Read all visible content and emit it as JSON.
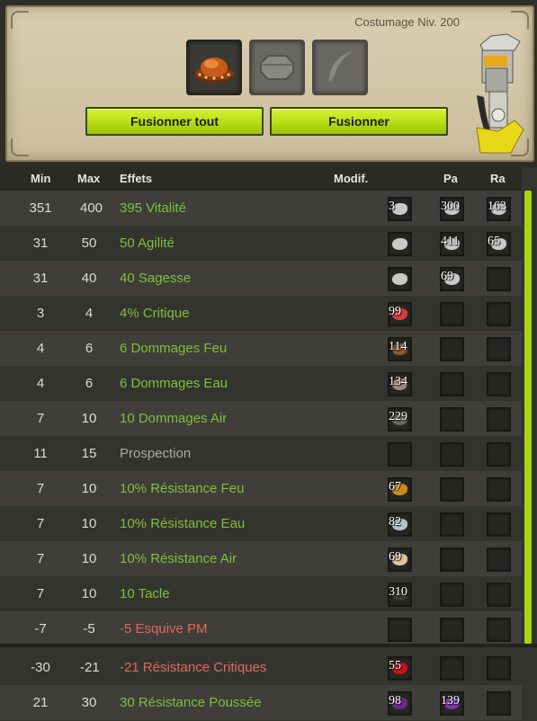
{
  "panel": {
    "title": "Costumage Niv. 200",
    "slots": [
      "hat-icon",
      "octagon-slot-icon",
      "feather-icon"
    ],
    "buttons": {
      "merge_all": "Fusionner tout",
      "merge": "Fusionner"
    }
  },
  "table": {
    "headers": {
      "min": "Min",
      "max": "Max",
      "effects": "Effets",
      "modif": "Modif.",
      "pa": "Pa",
      "ra": "Ra"
    },
    "rows": [
      {
        "min": "351",
        "max": "400",
        "effect": "395 Vitalité",
        "kind": "pos",
        "modif": "3",
        "pa": "300",
        "ra": "163",
        "color": "#c9c9c9"
      },
      {
        "min": "31",
        "max": "50",
        "effect": "50 Agilité",
        "kind": "pos",
        "modif": "",
        "pa": "411",
        "ra": "65",
        "color": "#c9c9c9"
      },
      {
        "min": "31",
        "max": "40",
        "effect": "40 Sagesse",
        "kind": "pos",
        "modif": "",
        "pa": "69",
        "ra": "",
        "color": "#c9c9c9"
      },
      {
        "min": "3",
        "max": "4",
        "effect": "4% Critique",
        "kind": "pos",
        "modif": "99",
        "pa": "",
        "ra": "",
        "color": "#d93a3a"
      },
      {
        "min": "4",
        "max": "6",
        "effect": "6 Dommages Feu",
        "kind": "pos",
        "modif": "114",
        "pa": "",
        "ra": "",
        "color": "#8a5a2a"
      },
      {
        "min": "4",
        "max": "6",
        "effect": "6 Dommages Eau",
        "kind": "pos",
        "modif": "134",
        "pa": "",
        "ra": "",
        "color": "#9a8a7a"
      },
      {
        "min": "7",
        "max": "10",
        "effect": "10 Dommages Air",
        "kind": "pos",
        "modif": "229",
        "pa": "",
        "ra": "",
        "color": "#6a6a62"
      },
      {
        "min": "11",
        "max": "15",
        "effect": "Prospection",
        "kind": "neu",
        "modif": "",
        "pa": "",
        "ra": "",
        "color": ""
      },
      {
        "min": "7",
        "max": "10",
        "effect": "10% Résistance Feu",
        "kind": "pos",
        "modif": "67",
        "pa": "",
        "ra": "",
        "color": "#c88a1a"
      },
      {
        "min": "7",
        "max": "10",
        "effect": "10% Résistance Eau",
        "kind": "pos",
        "modif": "82",
        "pa": "",
        "ra": "",
        "color": "#b8c0c8"
      },
      {
        "min": "7",
        "max": "10",
        "effect": "10% Résistance Air",
        "kind": "pos",
        "modif": "69",
        "pa": "",
        "ra": "",
        "color": "#d8c89a"
      },
      {
        "min": "7",
        "max": "10",
        "effect": "10 Tacle",
        "kind": "pos",
        "modif": "310",
        "pa": "",
        "ra": "",
        "color": "#3a3a36"
      },
      {
        "min": "-7",
        "max": "-5",
        "effect": "-5 Esquive PM",
        "kind": "neg",
        "modif": "",
        "pa": "",
        "ra": "",
        "color": ""
      },
      {
        "min": "-30",
        "max": "-21",
        "effect": "-21 Résistance Critiques",
        "kind": "neg",
        "modif": "55",
        "pa": "",
        "ra": "",
        "color": "#c01818"
      },
      {
        "min": "21",
        "max": "30",
        "effect": "30 Résistance Poussée",
        "kind": "pos",
        "modif": "98",
        "pa": "139",
        "ra": "",
        "color": "#6a2a8a",
        "pa_color": "#7a3aa8"
      }
    ]
  }
}
